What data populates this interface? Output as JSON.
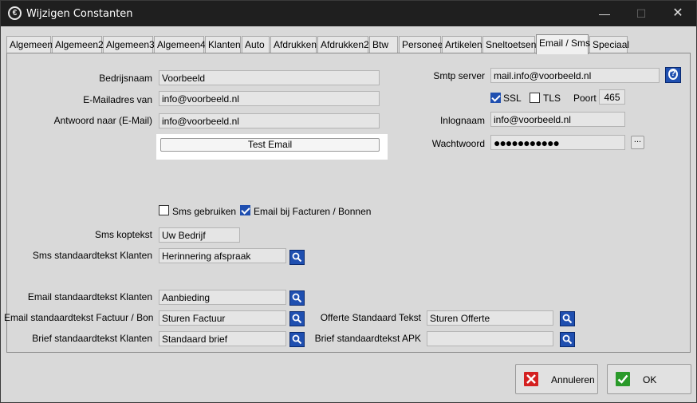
{
  "window": {
    "title": "Wijzigen Constanten",
    "min": "—",
    "max": "☐",
    "close": "✕"
  },
  "tabs": [
    {
      "label": "Algemeen"
    },
    {
      "label": "Algemeen2"
    },
    {
      "label": "Algemeen3"
    },
    {
      "label": "Algemeen4"
    },
    {
      "label": "Klanten"
    },
    {
      "label": "Auto"
    },
    {
      "label": "Afdrukken"
    },
    {
      "label": "Afdrukken2"
    },
    {
      "label": "Btw"
    },
    {
      "label": "Personeel"
    },
    {
      "label": "Artikelen"
    },
    {
      "label": "Sneltoetsen"
    },
    {
      "label": "Email / Sms"
    },
    {
      "label": "Speciaal"
    }
  ],
  "active_tab": "Email / Sms",
  "email": {
    "bedrijfsnaam_label": "Bedrijsnaam",
    "bedrijfsnaam_value": "Voorbeeld",
    "adres_label": "E-Mailadres van",
    "adres_value": "info@voorbeeld.nl",
    "antwoord_label": "Antwoord naar (E-Mail)",
    "antwoord_value": "info@voorbeeld.nl",
    "test_button": "Test Email"
  },
  "smtp": {
    "server_label": "Smtp server",
    "server_value": "mail.info@voorbeeld.nl",
    "help": "?",
    "ssl_label": "SSL",
    "ssl_checked": true,
    "tls_label": "TLS",
    "tls_checked": false,
    "poort_label": "Poort",
    "poort_value": "465",
    "login_label": "Inlognaam",
    "login_value": "info@voorbeeld.nl",
    "password_label": "Wachtwoord",
    "password_value": "●●●●●●●●●●●",
    "dots_button": "..."
  },
  "sms": {
    "gebruiken_label": "Sms gebruiken",
    "gebruiken_checked": false,
    "email_facturen_label": "Email bij Facturen / Bonnen",
    "email_facturen_checked": true,
    "kop_label": "Sms koptekst",
    "kop_value": "Uw Bedrijf",
    "standaard_label": "Sms standaardtekst Klanten",
    "standaard_value": "Herinnering afspraak"
  },
  "templates": {
    "email_klanten_label": "Email standaardtekst Klanten",
    "email_klanten_value": "Aanbieding",
    "email_factuur_label": "Email standaardtekst Factuur / Bon",
    "email_factuur_value": "Sturen Factuur",
    "brief_klanten_label": "Brief standaardtekst Klanten",
    "brief_klanten_value": "Standaard brief",
    "offerte_label": "Offerte Standaard Tekst",
    "offerte_value": "Sturen Offerte",
    "brief_apk_label": "Brief standaardtekst APK",
    "brief_apk_value": ""
  },
  "buttons": {
    "cancel_label": "Annuleren",
    "ok_label": "OK"
  },
  "colors": {
    "accent": "#1f4fb0",
    "titlebar": "#1f1f1f",
    "panel": "#d9d9d9"
  }
}
